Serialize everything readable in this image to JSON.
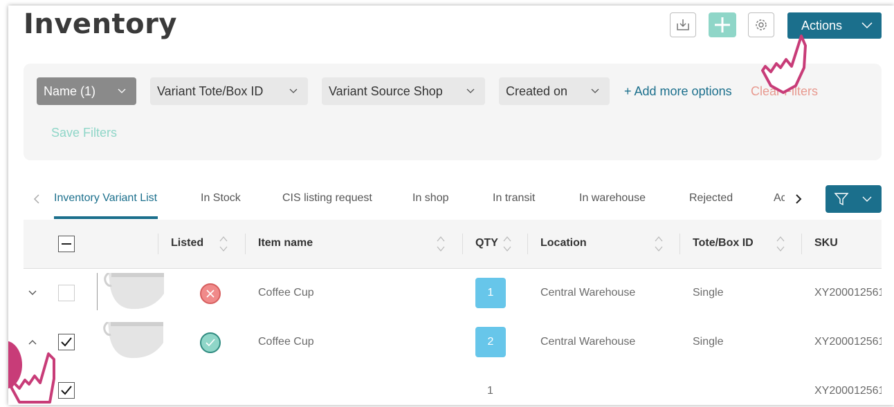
{
  "header": {
    "title": "Inventory",
    "actions_label": "Actions",
    "icons": [
      "download-icon",
      "plus-icon",
      "gear-icon",
      "chevron-down-icon"
    ]
  },
  "filters": {
    "buttons": [
      "Name (1)",
      "Variant Tote/Box ID",
      "Variant Source Shop",
      "Created on"
    ],
    "add_more": "+ Add more options",
    "clear": "Clear Filters",
    "save": "Save Filters"
  },
  "tabs": [
    "Inventory Variant List",
    "In Stock",
    "CIS listing request",
    "In shop",
    "In transit",
    "In warehouse",
    "Rejected",
    "Ac"
  ],
  "table": {
    "columns": [
      "Listed",
      "Item name",
      "QTY",
      "Location",
      "Tote/Box ID",
      "SKU"
    ],
    "rows": [
      {
        "item": "Coffee Cup",
        "qty": "1",
        "location": "Central Warehouse",
        "tote": "Single",
        "sku": "XY200012561!",
        "listed": "no",
        "checked": false
      },
      {
        "item": "Coffee Cup",
        "qty": "2",
        "location": "Central Warehouse",
        "tote": "Single",
        "sku": "XY200012561·",
        "listed": "yes",
        "checked": true
      },
      {
        "item": "",
        "qty": "1",
        "location": "",
        "tote": "",
        "sku": "XY200012561·",
        "listed": "",
        "checked": true
      }
    ]
  },
  "colors": {
    "accent": "#1b6f8c",
    "mint": "#8fd6c8",
    "qty_badge": "#67c6ea",
    "clear_text": "#e8998f",
    "pointer": "#c83c78"
  }
}
